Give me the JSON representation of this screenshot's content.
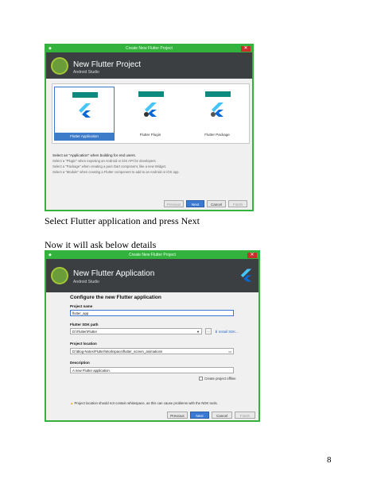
{
  "window1": {
    "title": "Create New Flutter Project",
    "header_title": "New Flutter Project",
    "header_subtitle": "Android Studio",
    "templates": [
      {
        "label": "Flutter Application",
        "selected": true
      },
      {
        "label": "Flutter Plugin",
        "selected": false
      },
      {
        "label": "Flutter Package",
        "selected": false
      }
    ],
    "desc": [
      "Select an \"Application\" when building for end users.",
      "Select a \"Plugin\" when exposing an Android or iOS API for developers.",
      "Select a \"Package\" when creating a pure Dart component, like a new Widget.",
      "Select a \"Module\" when creating a Flutter component to add to an Android or iOS app."
    ],
    "buttons": {
      "previous": "Previous",
      "next": "Next",
      "cancel": "Cancel",
      "finish": "Finish"
    }
  },
  "caption1": "Select Flutter application and press Next",
  "caption2": "Now it will ask below details",
  "window2": {
    "title": "Create New Flutter Project",
    "header_title": "New Flutter Application",
    "header_subtitle": "Android Studio",
    "form_title": "Configure the new Flutter application",
    "project_name_label": "Project name",
    "project_name_value": "flutter_app",
    "sdk_label": "Flutter SDK path",
    "sdk_value": "D:\\Flutter\\Flutter",
    "sdk_dots": "...",
    "install_sdk": "Install SDK...",
    "location_label": "Project location",
    "location_value": "D:\\Blog-Notes\\Flutter\\Workspace\\flutter_screen_animations",
    "description_label": "Description",
    "description_value": "A new Flutter application.",
    "offline_label": "Create project offline",
    "warning": "Project location should not contain whitespace, as this can cause problems with the NDK tools.",
    "buttons": {
      "previous": "Previous",
      "next": "Next",
      "cancel": "Cancel",
      "finish": "Finish"
    }
  },
  "page_number": "8",
  "colors": {
    "frame": "#33b33d",
    "header": "#3c3f41",
    "teal": "#0d8a7e",
    "accent": "#3b7ad4"
  }
}
